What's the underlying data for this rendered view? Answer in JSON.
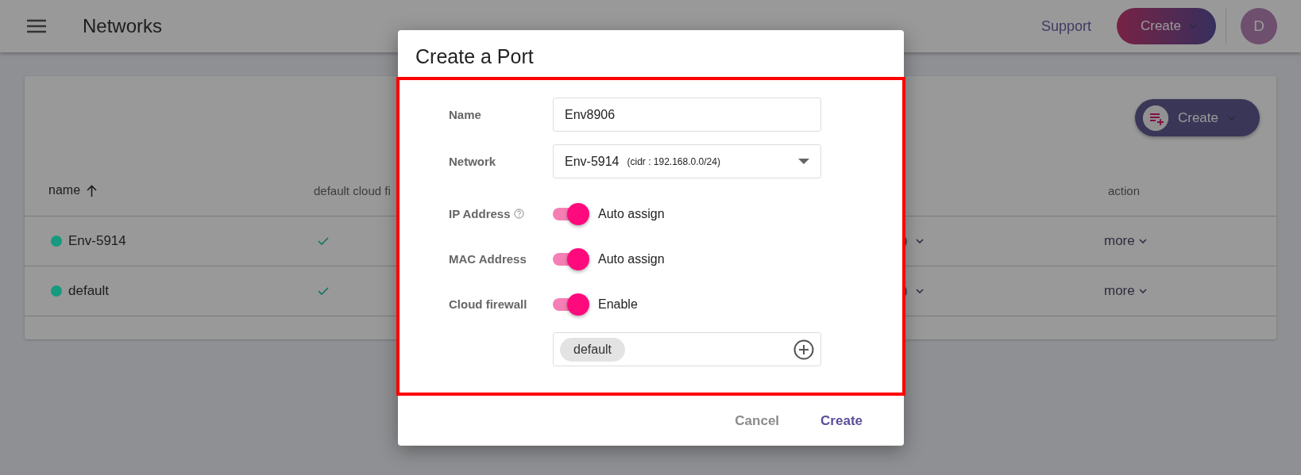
{
  "header": {
    "title": "Networks",
    "support": "Support",
    "create": "Create",
    "avatar": "D"
  },
  "table": {
    "create": "Create",
    "columns": [
      "name",
      "default cloud fi",
      "action"
    ],
    "rows": [
      {
        "name": "Env-5914",
        "color": "#179a7e",
        "default_cloud_firewall": true,
        "column_3": ")",
        "action": "more"
      },
      {
        "name": "default",
        "color": "#179a7e",
        "default_cloud_firewall": true,
        "column_3": ")",
        "action": "more"
      }
    ]
  },
  "dialog": {
    "title": "Create a Port",
    "highlighted": true,
    "fields": [
      {
        "kind": "text",
        "label": "Name",
        "value": "Env8906"
      },
      {
        "kind": "select",
        "label": "Network",
        "value": "Env-5914",
        "note": "(cidr : 192.168.0.0/24)"
      },
      {
        "kind": "toggle",
        "label": "IP Address",
        "help": true,
        "on": true,
        "text": "Auto assign"
      },
      {
        "kind": "toggle",
        "label": "MAC Address",
        "help": false,
        "on": true,
        "text": "Auto assign"
      },
      {
        "kind": "toggle",
        "label": "Cloud firewall",
        "help": false,
        "on": true,
        "text": "Enable"
      },
      {
        "kind": "tags",
        "tags": [
          "default"
        ]
      }
    ],
    "buttons": [
      {
        "label": "Cancel",
        "kind": "secondary"
      },
      {
        "label": "Create",
        "kind": "primary"
      }
    ]
  }
}
